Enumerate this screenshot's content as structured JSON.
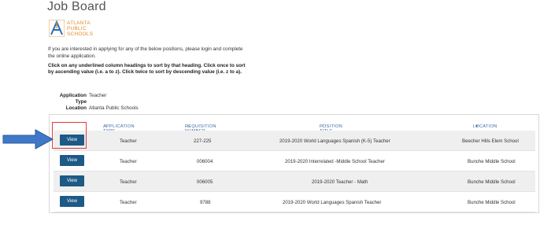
{
  "page": {
    "title": "Job Board"
  },
  "logo": {
    "line1": "ATLANTA",
    "line2": "PUBLIC",
    "line3": "SCHOOLS",
    "accent": "#e08a2a"
  },
  "intro_text": "If you are interested in applying for any of the below positions, please login and complete the online application.",
  "sort_help": "Click on any underlined column headings to sort by that heading. Click once to sort by ascending value (i.e. a to z). Click twice to sort by descending value (i.e. z to a).",
  "filters": [
    {
      "key": "Application Type",
      "value": "Teacher"
    },
    {
      "key": "Location",
      "value": "Atlanta Public Schools"
    }
  ],
  "table": {
    "headers": {
      "application_type": "APPLICATION TYPE",
      "requisition_number": "REQUISITION NUMBER",
      "position_title": "POSITION TITLE",
      "location": "LOCATION"
    },
    "sort_indicators": {
      "unsorted": "⇕",
      "descending": "▼"
    },
    "view_label": "View",
    "rows": [
      {
        "application_type": "Teacher",
        "requisition_number": "227-225",
        "position_title": "2019-2020 World Languages Spanish (K-5) Teacher",
        "location": "Beecher Hills Elem School"
      },
      {
        "application_type": "Teacher",
        "requisition_number": "006004",
        "position_title": "2019-2020 Interrelated -Middle School Teacher",
        "location": "Bunche Middle School"
      },
      {
        "application_type": "Teacher",
        "requisition_number": "006005",
        "position_title": "2019-2020 Teacher - Math",
        "location": "Bunche Middle School"
      },
      {
        "application_type": "Teacher",
        "requisition_number": "9788",
        "position_title": "2019-2020 World Languages Spanish Teacher",
        "location": "Bunche Middle School"
      }
    ]
  },
  "annotation": {
    "highlight_color": "#e03b3b",
    "arrow_color": "#3f78c8"
  }
}
